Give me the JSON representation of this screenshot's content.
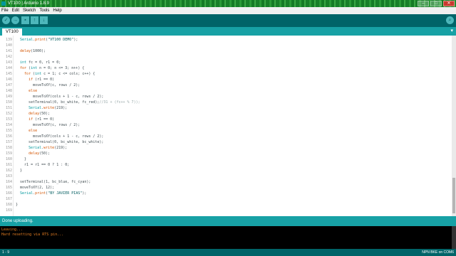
{
  "window": {
    "title": "VT100 | Arduino 1.8.9",
    "min": "–",
    "max": "□",
    "close": "✕"
  },
  "menu": [
    "File",
    "Edit",
    "Sketch",
    "Tools",
    "Help"
  ],
  "toolbar": {
    "verify": "✓",
    "upload": "→",
    "new": "▪",
    "open": "↑",
    "save": "↓",
    "serial_monitor": "⌕"
  },
  "tab": {
    "name": "VT100",
    "menu": "▾"
  },
  "code_lines": [
    {
      "n": "139",
      "html": "  <span class=\"t\">Serial</span>.<span class=\"k\">print</span>(<span class=\"s\">\"VT100 DEMO\"</span>);"
    },
    {
      "n": "140",
      "html": ""
    },
    {
      "n": "141",
      "html": "  <span class=\"k\">delay</span>(1000);"
    },
    {
      "n": "142",
      "html": ""
    },
    {
      "n": "143",
      "html": "  <span class=\"t\">int</span> fc = 0, r1 = 0;"
    },
    {
      "n": "144",
      "html": "  <span class=\"k\">for</span> (<span class=\"t\">int</span> n = 0; n &lt;= 3; n++) {"
    },
    {
      "n": "145",
      "html": "    <span class=\"k\">for</span> (<span class=\"t\">int</span> c = 1; c &lt;= cols; c++) {"
    },
    {
      "n": "146",
      "html": "      <span class=\"k\">if</span> (r1 == 0)"
    },
    {
      "n": "147",
      "html": "        moveToXY(c, rows / 2);"
    },
    {
      "n": "148",
      "html": "      <span class=\"k\">else</span>"
    },
    {
      "n": "149",
      "html": "        moveToXY(cols + 1 - c, rows / 2);"
    },
    {
      "n": "150",
      "html": "      setTerminal(0, bc_white, fc_red);<span class=\"c\">//31 + (fc++ % 7));</span>"
    },
    {
      "n": "151",
      "html": "      <span class=\"t\">Serial</span>.<span class=\"k\">write</span>(219);"
    },
    {
      "n": "152",
      "html": "      <span class=\"k\">delay</span>(50);"
    },
    {
      "n": "153",
      "html": "      <span class=\"k\">if</span> (r1 == 0)"
    },
    {
      "n": "154",
      "html": "        moveToXY(c, rows / 2);"
    },
    {
      "n": "155",
      "html": "      <span class=\"k\">else</span>"
    },
    {
      "n": "156",
      "html": "        moveToXY(cols + 1 - c, rows / 2);"
    },
    {
      "n": "157",
      "html": "      setTerminal(0, bc_white, bc_white);"
    },
    {
      "n": "158",
      "html": "      <span class=\"t\">Serial</span>.<span class=\"k\">write</span>(219);"
    },
    {
      "n": "159",
      "html": "      <span class=\"k\">delay</span>(50);"
    },
    {
      "n": "160",
      "html": "    }"
    },
    {
      "n": "161",
      "html": "    r1 = r1 == 0 ? 1 : 0;"
    },
    {
      "n": "162",
      "html": "  }"
    },
    {
      "n": "163",
      "html": ""
    },
    {
      "n": "164",
      "html": "  setTerminal(1, bc_blue, fc_cyan);"
    },
    {
      "n": "165",
      "html": "  moveToXY(2, 12);"
    },
    {
      "n": "166",
      "html": "  <span class=\"t\">Serial</span>.<span class=\"k\">print</span>(<span class=\"s\">\"BY JAVIER PIAS\"</span>);"
    },
    {
      "n": "167",
      "html": ""
    },
    {
      "n": "168",
      "html": "}"
    },
    {
      "n": "169",
      "html": ""
    }
  ],
  "status": {
    "message": "Done uploading."
  },
  "console_lines": [
    "Leaving...",
    "Hard resetting via RTS pin..."
  ],
  "footer": {
    "line": "1 - 9",
    "board": "NPN BKE on COM6"
  },
  "colors": {
    "teal_dark": "#006468",
    "teal": "#17a1a5",
    "keyword": "#d35400",
    "type": "#00979c",
    "console_text": "#e67e22"
  }
}
